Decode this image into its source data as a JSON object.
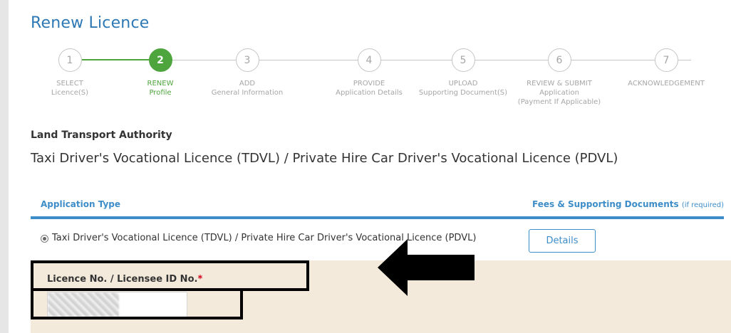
{
  "page": {
    "title": "Renew Licence"
  },
  "stepper": {
    "steps": [
      {
        "number": "1",
        "line1": "SELECT",
        "line2": "Licence(S)",
        "line3": "",
        "state": "inactive"
      },
      {
        "number": "2",
        "line1": "RENEW",
        "line2": "Profile",
        "line3": "",
        "state": "active"
      },
      {
        "number": "3",
        "line1": "ADD",
        "line2": "General Information",
        "line3": "",
        "state": "inactive"
      },
      {
        "number": "4",
        "line1": "PROVIDE",
        "line2": "Application Details",
        "line3": "",
        "state": "inactive"
      },
      {
        "number": "5",
        "line1": "UPLOAD",
        "line2": "Supporting Document(S)",
        "line3": "",
        "state": "inactive"
      },
      {
        "number": "6",
        "line1": "REVIEW & SUBMIT",
        "line2": "Application",
        "line3": "(Payment If Applicable)",
        "state": "inactive"
      },
      {
        "number": "7",
        "line1": "ACKNOWLEDGEMENT",
        "line2": "",
        "line3": "",
        "state": "inactive"
      }
    ]
  },
  "agency": "Land Transport Authority",
  "licence_title": "Taxi Driver's Vocational Licence (TDVL) / Private Hire Car Driver's Vocational Licence (PDVL)",
  "table_header": {
    "application_type": "Application Type",
    "fees": "Fees & Supporting Documents",
    "fees_hint": "(if required)"
  },
  "option": {
    "label": "Taxi Driver's Vocational Licence (TDVL) / Private Hire Car Driver's Vocational Licence (PDVL)",
    "selected": true,
    "details_button": "Details"
  },
  "form": {
    "licence_label": "Licence No. / Licensee ID No.",
    "required_marker": "*"
  },
  "colors": {
    "title_blue": "#2e78b4",
    "accent_blue": "#3d8dc8",
    "active_green": "#4ea53e",
    "panel_beige": "#f3eadb",
    "required_red": "#d0021b"
  }
}
